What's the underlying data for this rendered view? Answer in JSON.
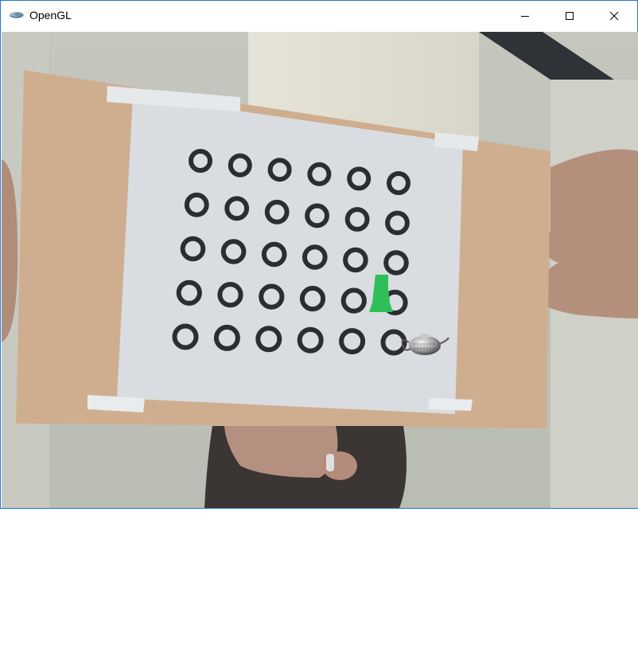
{
  "window": {
    "title": "OpenGL",
    "app_icon": "opengl-app-icon",
    "controls": [
      "minimize-icon",
      "maximize-icon",
      "close-icon"
    ]
  },
  "scene": {
    "grid_rows": 5,
    "grid_cols": 6,
    "overlays": [
      "green-chess-piece",
      "teapot-model"
    ]
  }
}
